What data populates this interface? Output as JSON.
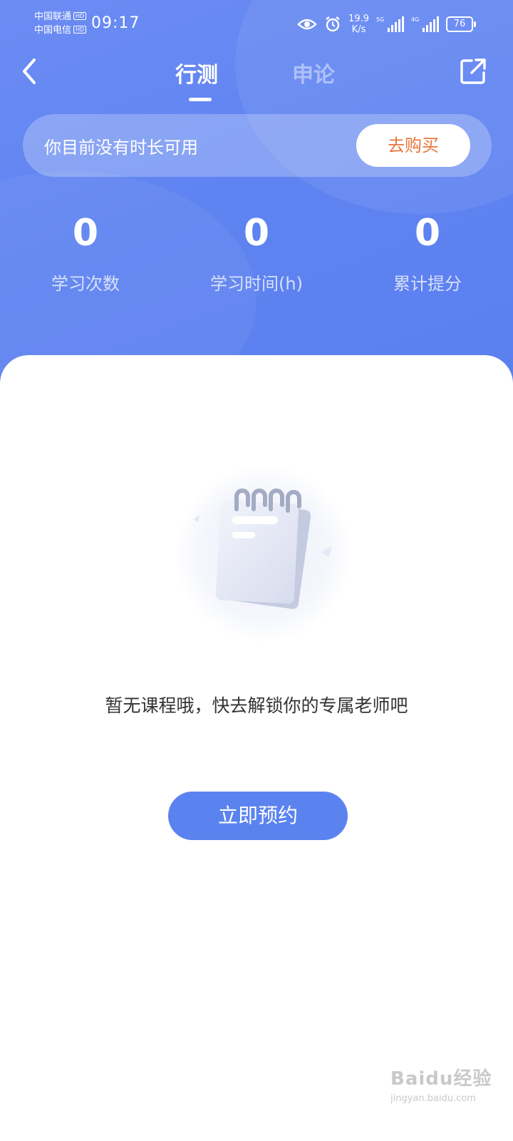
{
  "status_bar": {
    "carrier_1": "中国联通",
    "carrier_2": "中国电信",
    "hd_badge": "HD",
    "time": "09:17",
    "net_speed_value": "19.9",
    "net_speed_unit": "K/s",
    "signal_1_tag": "5G",
    "signal_2_tag": "4G",
    "battery": "76",
    "icons": [
      "eye-icon",
      "alarm-icon"
    ]
  },
  "nav": {
    "tabs": [
      {
        "label": "行测",
        "active": true
      },
      {
        "label": "申论",
        "active": false
      }
    ],
    "back_icon": "chevron-left-icon",
    "share_icon": "external-link-icon"
  },
  "balance": {
    "message": "你目前没有时长可用",
    "buy_label": "去购买"
  },
  "stats": [
    {
      "value": "0",
      "label": "学习次数"
    },
    {
      "value": "0",
      "label": "学习时间(h)"
    },
    {
      "value": "0",
      "label": "累计提分"
    }
  ],
  "empty_state": {
    "illustration": "notebook-illustration",
    "message": "暂无课程哦，快去解锁你的专属老师吧",
    "button_label": "立即预约"
  },
  "watermark": {
    "main": "Baidu经验",
    "sub": "jingyan.baidu.com"
  },
  "colors": {
    "hero": "#5f84f1",
    "primary_button": "#5b83ef",
    "buy_text": "#e8773a"
  }
}
